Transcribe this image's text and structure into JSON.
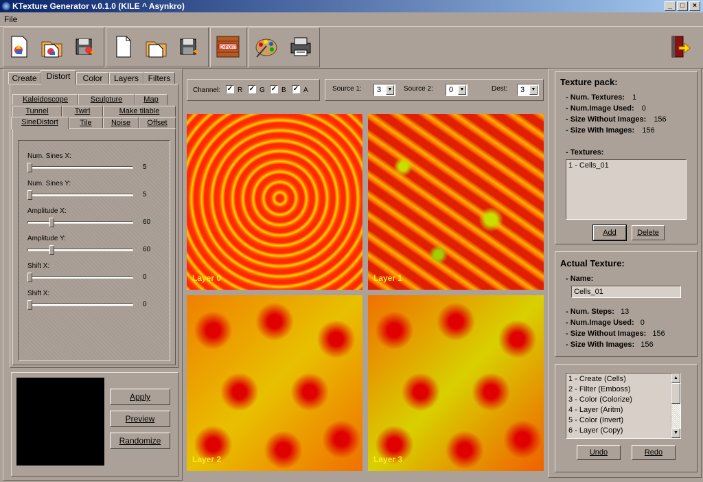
{
  "window": {
    "title": "KTexture Generator v.0.1.0 (KILE ^ Asynkro)",
    "min": "_",
    "max": "□",
    "close": "×"
  },
  "menu": {
    "file": "File"
  },
  "toolbar": {
    "icons": [
      "new-pack-icon",
      "open-pack-icon",
      "save-pack-icon",
      "new-texture-icon",
      "open-texture-icon",
      "save-texture-icon",
      "export-icon",
      "palette-icon",
      "printer-icon",
      "exit-icon"
    ],
    "export_label": "EXPORT"
  },
  "tabs": {
    "main": [
      "Create",
      "Distort",
      "Color",
      "Layers",
      "Filters"
    ],
    "selected": "Distort"
  },
  "subtabs": {
    "row1": [
      "Kaleidoscope",
      "Sculpture",
      "Map"
    ],
    "row2": [
      "Tunnel",
      "Twirl",
      "Make tilable"
    ],
    "row3": [
      "SineDistort",
      "Tile",
      "Noise",
      "Offset"
    ],
    "selected": "SineDistort"
  },
  "params": [
    {
      "label": "Num. Sines X:",
      "value": "5",
      "pos": 0.0
    },
    {
      "label": "Num. Sines Y:",
      "value": "5",
      "pos": 0.0
    },
    {
      "label": "Amplitude X:",
      "value": "60",
      "pos": 0.22
    },
    {
      "label": "Amplitude Y:",
      "value": "60",
      "pos": 0.22
    },
    {
      "label": "Shift X:",
      "value": "0",
      "pos": 0.0
    },
    {
      "label": "Shift X:",
      "value": "0",
      "pos": 0.0
    }
  ],
  "actions": {
    "apply": "Apply",
    "preview": "Preview",
    "randomize": "Randomize"
  },
  "channel": {
    "label": "Channel:",
    "r": "R",
    "g": "G",
    "b": "B",
    "a": "A",
    "check": "✓"
  },
  "sources": {
    "source1_label": "Source 1:",
    "source1": "3",
    "source2_label": "Source 2:",
    "source2": "0",
    "dest_label": "Dest:",
    "dest": "3"
  },
  "layers": [
    "Layer 0",
    "Layer 1",
    "Layer 2",
    "Layer 3"
  ],
  "pack": {
    "title": "Texture pack:",
    "num_textures_label": "- Num. Textures:",
    "num_textures": "1",
    "num_images_label": "- Num.Image Used:",
    "num_images": "0",
    "size_without_label": "- Size Without Images:",
    "size_without": "156",
    "size_with_label": "- Size With Images:",
    "size_with": "156",
    "textures_label": "- Textures:",
    "textures": [
      "1 - Cells_01"
    ],
    "add": "Add",
    "delete": "Delete"
  },
  "actual": {
    "title": "Actual Texture:",
    "name_label": "- Name:",
    "name": "Cells_01",
    "num_steps_label": "- Num. Steps:",
    "num_steps": "13",
    "num_images_label": "- Num.Image Used:",
    "num_images": "0",
    "size_without_label": "- Size Without Images:",
    "size_without": "156",
    "size_with_label": "- Size With Images:",
    "size_with": "156"
  },
  "history": {
    "steps": [
      "1 - Create (Cells)",
      "2 - Filter (Emboss)",
      "3 - Color (Colorize)",
      "4 - Layer (Aritm)",
      "5 - Color (Invert)",
      "6 - Layer (Copy)"
    ],
    "undo": "Undo",
    "redo": "Redo"
  },
  "colors": {
    "bg": "#aca198",
    "texture_red": "#e01010",
    "texture_yellow": "#ffe000"
  }
}
